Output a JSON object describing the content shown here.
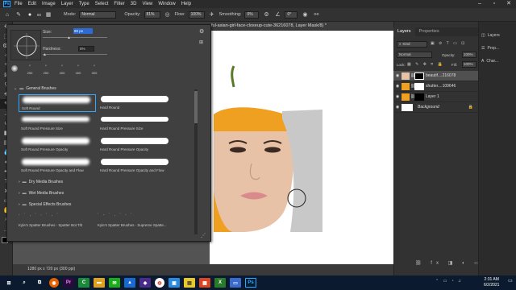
{
  "menubar": {
    "logo": "Ps",
    "items": [
      "File",
      "Edit",
      "Image",
      "Layer",
      "Type",
      "Select",
      "Filter",
      "3D",
      "View",
      "Window",
      "Help"
    ]
  },
  "options": {
    "mode_label": "Mode:",
    "mode_value": "Normal",
    "opacity_label": "Opacity:",
    "opacity_value": "81%",
    "flow_label": "Flow:",
    "flow_value": "100%",
    "smoothing_label": "Smoothing:",
    "smoothing_value": "0%",
    "angle_value": "0°",
    "brush_size": "80"
  },
  "document": {
    "tab_title": "ful-asian-girl-face-closeup-cute-36216078, Layer Mask/8) *",
    "status": "1280 px x 720 px (300 ppi)"
  },
  "brush_panel": {
    "size_label": "Size:",
    "size_value": "80 px",
    "hardness_label": "Hardness:",
    "hardness_value": "0%",
    "recent_sizes": [
      "250",
      "250",
      "400",
      "400",
      "300"
    ],
    "general_folder": "General Brushes",
    "brushes": [
      "Soft Round",
      "Hard Round",
      "Soft Round Pressure Size",
      "Hard Round Pressure Size",
      "Soft Round Pressure Opacity",
      "Hard Round Pressure Opacity",
      "Soft Round Pressure Opacity and Flow",
      "Hard Round Pressure Opacity and Flow"
    ],
    "folders": [
      "Dry Media Brushes",
      "Wet Media Brushes",
      "Special Effects Brushes"
    ],
    "spatter_1": "Kyle's Spatter Brushes - Spatter Bot Tilt",
    "spatter_2": "Kyle's Spatter Brushes - Supreme Spatte..."
  },
  "layers_panel": {
    "tab_layers": "Layers",
    "tab_properties": "Properties",
    "kind_label": "Kind",
    "blend_mode": "Normal",
    "opacity_label": "Opacity:",
    "opacity_value": "100%",
    "lock_label": "Lock:",
    "fill_label": "Fill:",
    "fill_value": "100%",
    "layers": [
      "beautif....216078",
      "shutter....109646",
      "Layer 1",
      "Background"
    ]
  },
  "side_strip": {
    "items": [
      "Layers",
      "Prop...",
      "Char..."
    ]
  },
  "taskbar": {
    "time": "2:31 AM",
    "date": "6/2/2021",
    "apps": [
      "firefox",
      "pr",
      "camtasia",
      "files",
      "wechat",
      "premiere",
      "arrow",
      "chrome",
      "photos",
      "maps",
      "calc",
      "x",
      "explorer",
      "ps"
    ],
    "ps_label": "Ps",
    "pr_label": "Pr"
  },
  "colors": {
    "accent": "#31a8ff",
    "panel": "#404040",
    "dark": "#323232"
  }
}
